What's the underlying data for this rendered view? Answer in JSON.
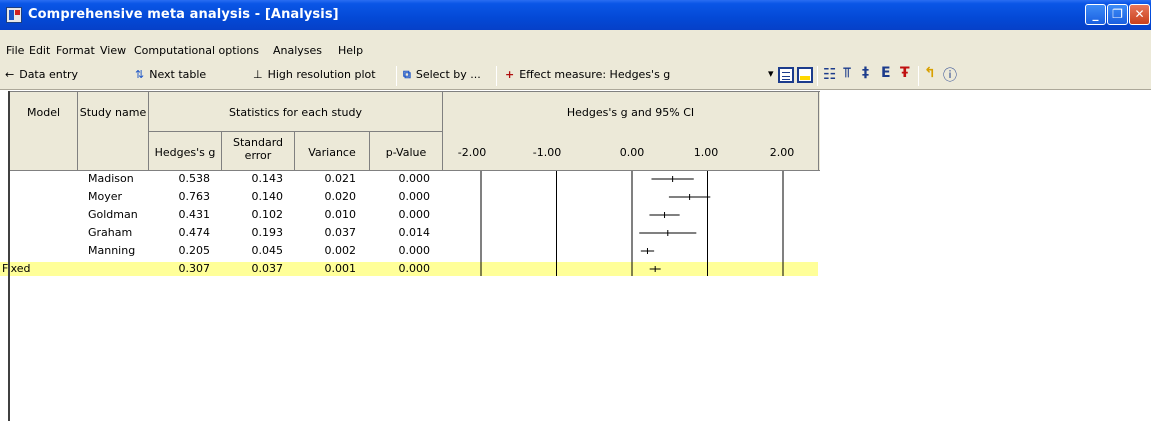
{
  "window": {
    "title": "Comprehensive meta analysis - [Analysis]"
  },
  "menu": [
    "File",
    "Edit",
    "Format",
    "View",
    "Computational options",
    "Analyses",
    "Help"
  ],
  "toolbar": {
    "data_entry": "Data entry",
    "next_table": "Next table",
    "high_res_plot": "High resolution plot",
    "select_by": "Select by ...",
    "effect_measure": "Effect measure: Hedges's g"
  },
  "table": {
    "col_model": "Model",
    "col_study": "Study name",
    "group_stats": "Statistics for each study",
    "group_plot": "Hedges's g and 95% CI",
    "col_g": "Hedges's g",
    "col_se": "Standard error",
    "col_var": "Variance",
    "col_p": "p-Value",
    "axis_ticks": [
      "-2.00",
      "-1.00",
      "0.00",
      "1.00",
      "2.00"
    ],
    "rows": [
      {
        "model": "",
        "study": "Madison",
        "g": "0.538",
        "se": "0.143",
        "var": "0.021",
        "p": "0.000"
      },
      {
        "model": "",
        "study": "Moyer",
        "g": "0.763",
        "se": "0.140",
        "var": "0.020",
        "p": "0.000"
      },
      {
        "model": "",
        "study": "Goldman",
        "g": "0.431",
        "se": "0.102",
        "var": "0.010",
        "p": "0.000"
      },
      {
        "model": "",
        "study": "Graham",
        "g": "0.474",
        "se": "0.193",
        "var": "0.037",
        "p": "0.014"
      },
      {
        "model": "",
        "study": "Manning",
        "g": "0.205",
        "se": "0.045",
        "var": "0.002",
        "p": "0.000"
      },
      {
        "model": "Fixed",
        "study": "",
        "g": "0.307",
        "se": "0.037",
        "var": "0.001",
        "p": "0.000"
      }
    ]
  },
  "chart_data": {
    "type": "scatter",
    "title": "Hedges's g and 95% CI",
    "xlim": [
      -2.0,
      2.0
    ],
    "x_ticks": [
      -2.0,
      -1.0,
      0.0,
      1.0,
      2.0
    ],
    "series": [
      {
        "values": [
          {
            "study": "Madison",
            "g": 0.538,
            "lower": 0.258,
            "upper": 0.818
          },
          {
            "study": "Moyer",
            "g": 0.763,
            "lower": 0.489,
            "upper": 1.037
          },
          {
            "study": "Goldman",
            "g": 0.431,
            "lower": 0.231,
            "upper": 0.631
          },
          {
            "study": "Graham",
            "g": 0.474,
            "lower": 0.096,
            "upper": 0.852
          },
          {
            "study": "Manning",
            "g": 0.205,
            "lower": 0.117,
            "upper": 0.293
          },
          {
            "study": "Fixed",
            "g": 0.307,
            "lower": 0.234,
            "upper": 0.38
          }
        ]
      }
    ]
  }
}
